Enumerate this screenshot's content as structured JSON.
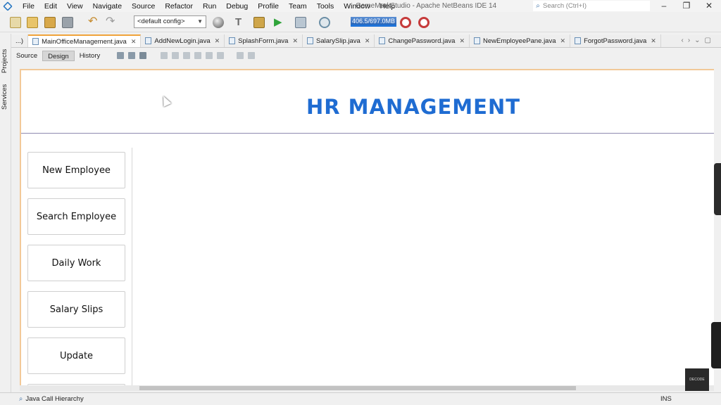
{
  "menu": [
    "File",
    "Edit",
    "View",
    "Navigate",
    "Source",
    "Refactor",
    "Run",
    "Debug",
    "Profile",
    "Team",
    "Tools",
    "Window",
    "Help"
  ],
  "window_title": "GameMarkStudio - Apache NetBeans IDE 14",
  "search": {
    "placeholder": "Search (Ctrl+I)"
  },
  "window_controls": {
    "minimize": "–",
    "restore": "❐",
    "close": "✕"
  },
  "toolbar": {
    "config": "<default config>",
    "memory": "406.5/697.0MB"
  },
  "side_panels": [
    "Projects",
    "Services"
  ],
  "tabs": [
    {
      "label": "...)"
    },
    {
      "label": "MainOfficeManagement.java",
      "active": true
    },
    {
      "label": "AddNewLogin.java"
    },
    {
      "label": "SplashForm.java"
    },
    {
      "label": "SalarySlip.java"
    },
    {
      "label": "ChangePassword.java"
    },
    {
      "label": "NewEmployeePane.java"
    },
    {
      "label": "ForgotPassword.java"
    }
  ],
  "design_tabs": [
    "Source",
    "Design",
    "History"
  ],
  "app": {
    "title": "HR MANAGEMENT",
    "nav_buttons": [
      "New Employee",
      "Search Employee",
      "Daily Work",
      "Salary Slips",
      "Update"
    ]
  },
  "watermark": "DECODE",
  "status": {
    "hierarchy": "Java Call Hierarchy",
    "mode": "INS"
  },
  "colors": {
    "title_blue": "#1f6cd2",
    "active_tab_accent": "#f0a33a",
    "memory_bar": "#1e73d8"
  }
}
